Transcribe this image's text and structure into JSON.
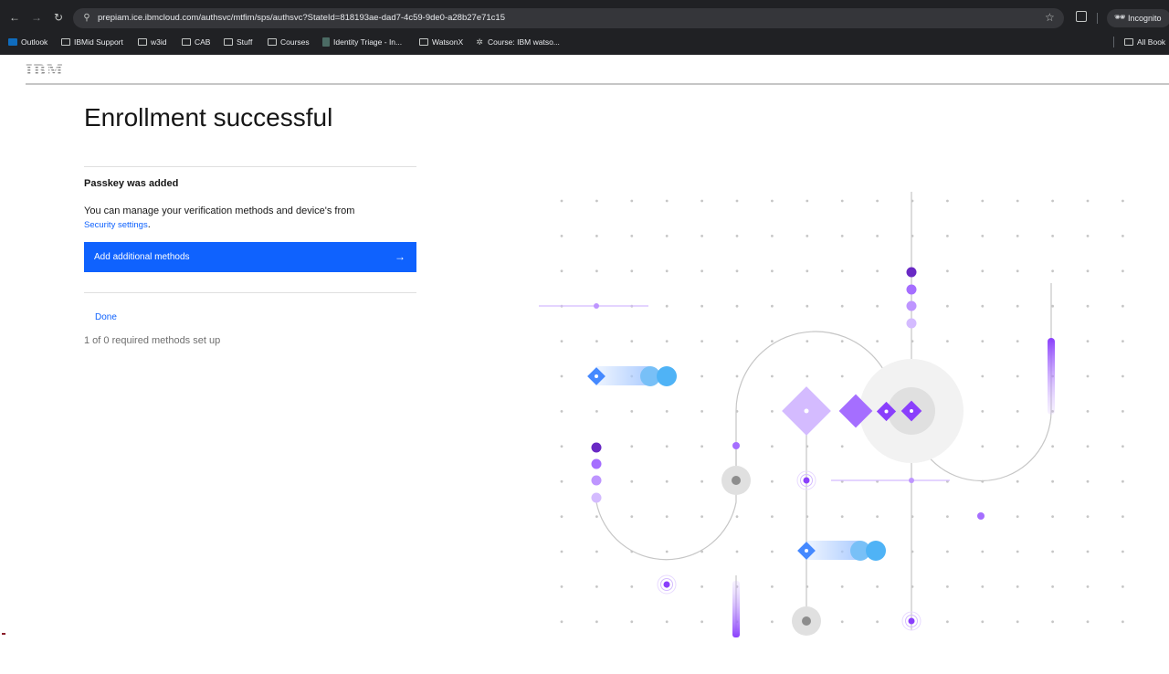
{
  "browser": {
    "url": "prepiam.ice.ibmcloud.com/authsvc/mtfim/sps/authsvc?StateId=818193ae-dad7-4c59-9de0-a28b27e71c15",
    "incognito_label": "Incognito",
    "bookmarks": [
      {
        "label": "Outlook",
        "icon": "outlook-icon"
      },
      {
        "label": "IBMid Support",
        "icon": "folder-icon"
      },
      {
        "label": "w3id",
        "icon": "folder-icon"
      },
      {
        "label": "CAB",
        "icon": "folder-icon"
      },
      {
        "label": "Stuff",
        "icon": "folder-icon"
      },
      {
        "label": "Courses",
        "icon": "folder-icon"
      },
      {
        "label": "Identity Triage - In...",
        "icon": "doc-icon"
      },
      {
        "label": "WatsonX",
        "icon": "folder-icon"
      },
      {
        "label": "Course: IBM watso...",
        "icon": "course-icon"
      }
    ],
    "all_bookmarks_label": "All Book"
  },
  "header": {
    "logo_text": "IBM"
  },
  "main": {
    "title": "Enrollment successful",
    "subtitle": "Passkey was added",
    "description": "You can manage your verification methods and device's from",
    "settings_link": "Security settings",
    "primary_button_label": "Add additional methods",
    "done_label": "Done",
    "status_text": "1 of 0 required methods set up"
  },
  "colors": {
    "primary": "#0f62fe",
    "purple_dark": "#6929c4",
    "purple": "#8a3ffc",
    "purple_light": "#be95ff",
    "lavender": "#d4bbff",
    "cyan": "#4589ff",
    "sky": "#78c0f7",
    "gray_node": "#dde1e6"
  }
}
